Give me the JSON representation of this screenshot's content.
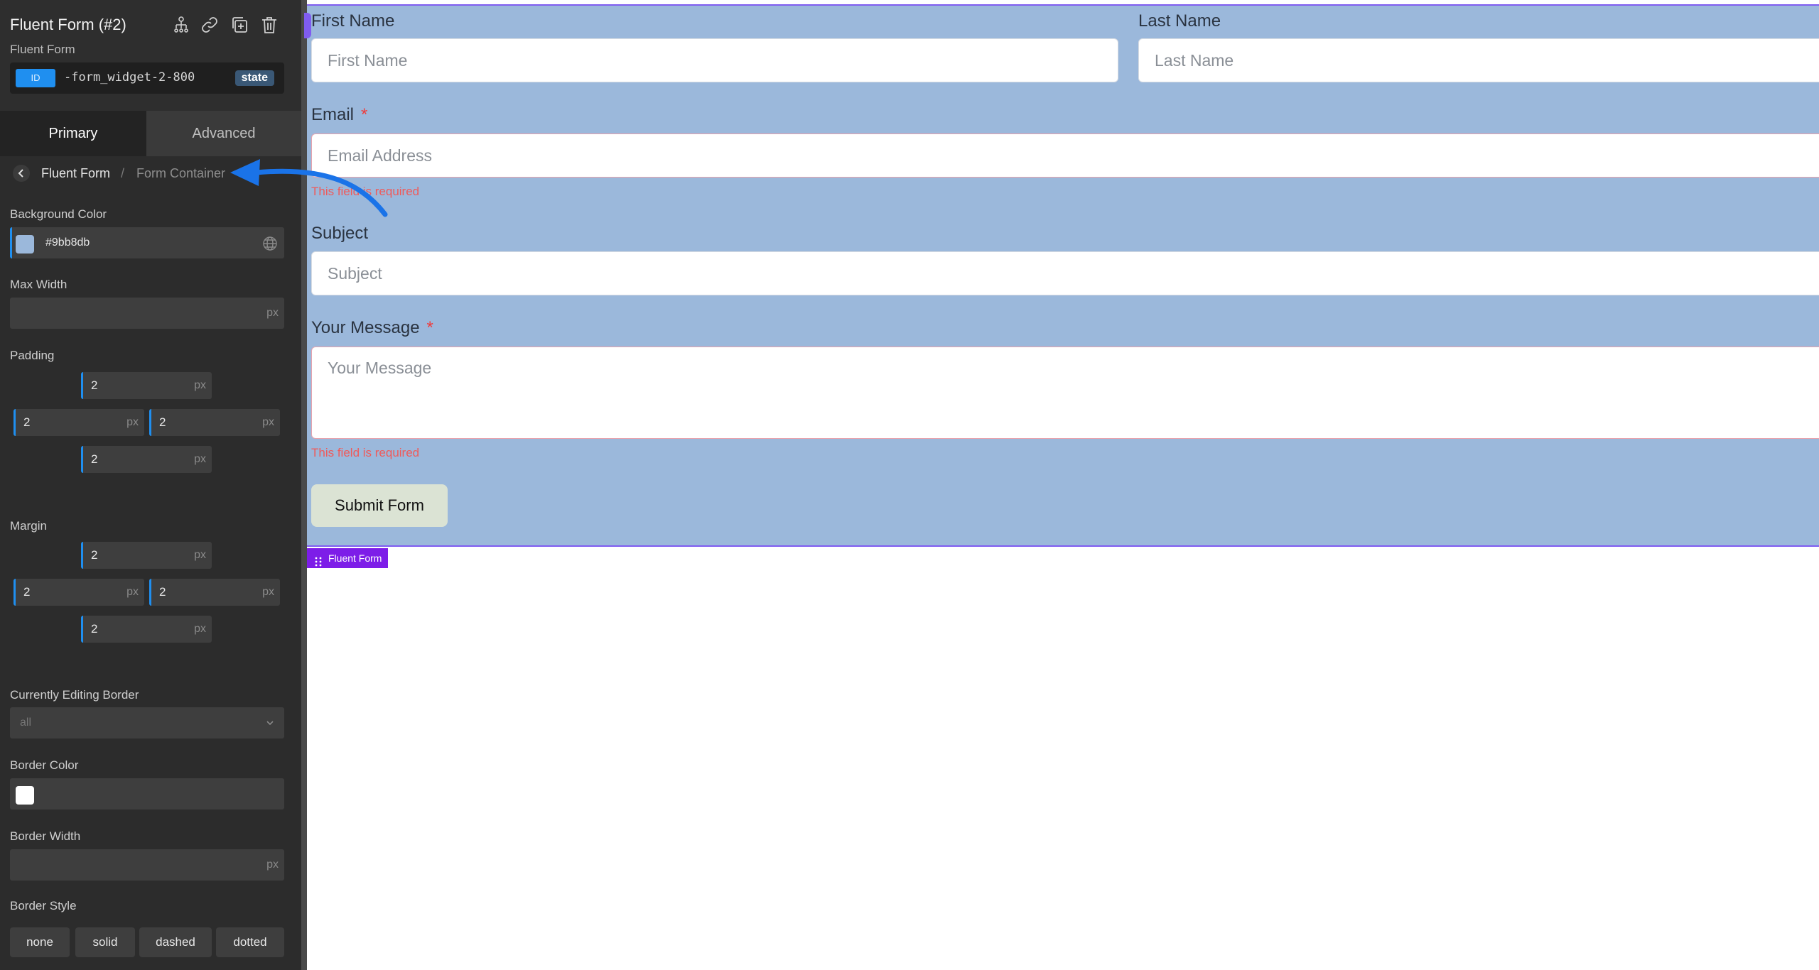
{
  "sidebar": {
    "header": {
      "title": "Fluent Form (#2)",
      "subtitle": "Fluent Form",
      "icons": [
        "structure-icon",
        "link-icon",
        "duplicate-icon",
        "trash-icon"
      ],
      "id_badge": "ID",
      "id_value": "-form_widget-2-800",
      "state_badge": "state"
    },
    "tabs": {
      "primary": "Primary",
      "advanced": "Advanced"
    },
    "breadcrumb": {
      "item1": "Fluent Form",
      "separator": "/",
      "item2": "Form Container"
    },
    "background_color": {
      "label": "Background Color",
      "value": "#9bb8db",
      "swatch_color": "#9bb8db"
    },
    "max_width": {
      "label": "Max Width",
      "value": "",
      "unit": "px"
    },
    "padding": {
      "label": "Padding",
      "top": "2",
      "left": "2",
      "right": "2",
      "bottom": "2",
      "unit": "px"
    },
    "margin": {
      "label": "Margin",
      "top": "2",
      "left": "2",
      "right": "2",
      "bottom": "2",
      "unit": "px"
    },
    "editing_border": {
      "label": "Currently Editing Border",
      "value": "all"
    },
    "border_color": {
      "label": "Border Color",
      "swatch_color": "#ffffff"
    },
    "border_width": {
      "label": "Border Width",
      "value": "",
      "unit": "px"
    },
    "border_style": {
      "label": "Border Style",
      "options": [
        "none",
        "solid",
        "dashed",
        "dotted"
      ]
    }
  },
  "form": {
    "background": "#9bb8db",
    "first_name": {
      "label": "First Name",
      "placeholder": "First Name"
    },
    "last_name": {
      "label": "Last Name",
      "placeholder": "Last Name"
    },
    "email": {
      "label": "Email",
      "required_mark": "*",
      "placeholder": "Email Address",
      "error": "This field is required"
    },
    "subject": {
      "label": "Subject",
      "placeholder": "Subject"
    },
    "message": {
      "label": "Your Message",
      "required_mark": "*",
      "placeholder": "Your Message",
      "error": "This field is required"
    },
    "submit_label": "Submit Form",
    "element_tag": "Fluent Form"
  },
  "colors": {
    "accent": "#1f8ff0",
    "selection_outline": "#7f5cf0",
    "error": "#ef3b3b",
    "annotation_arrow": "#1a73e8"
  }
}
